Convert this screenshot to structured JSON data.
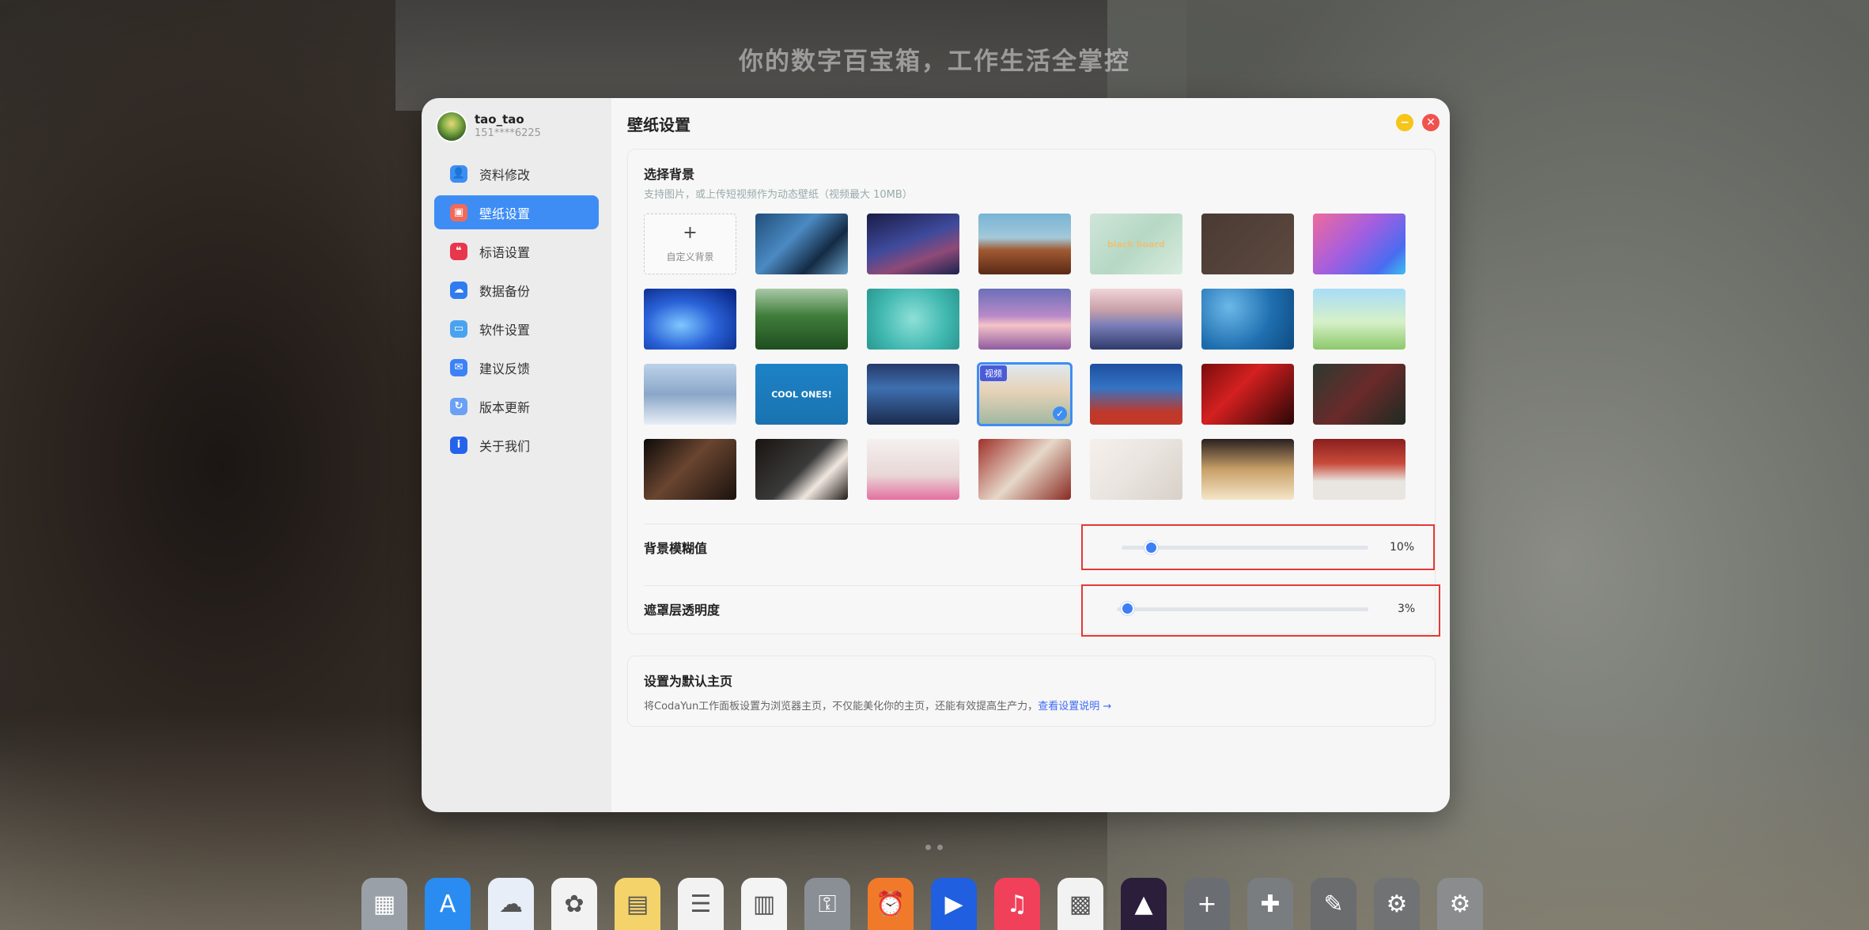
{
  "background": {
    "slogan": "你的数字百宝箱，工作生活全掌控"
  },
  "sidebar": {
    "user": {
      "name": "tao_tao",
      "phone": "151****6225"
    },
    "items": [
      {
        "label": "资料修改",
        "icon": "user-edit-icon",
        "color": "#3e8df5",
        "active": false
      },
      {
        "label": "壁纸设置",
        "icon": "wallpaper-icon",
        "color": "#f06a5a",
        "active": true
      },
      {
        "label": "标语设置",
        "icon": "slogan-icon",
        "color": "#e8364b",
        "active": false
      },
      {
        "label": "数据备份",
        "icon": "cloud-icon",
        "color": "#2f7cf0",
        "active": false
      },
      {
        "label": "软件设置",
        "icon": "monitor-icon",
        "color": "#4aa3f0",
        "active": false
      },
      {
        "label": "建议反馈",
        "icon": "feedback-icon",
        "color": "#3b82f6",
        "active": false
      },
      {
        "label": "版本更新",
        "icon": "update-icon",
        "color": "#6aa0f5",
        "active": false
      },
      {
        "label": "关于我们",
        "icon": "info-icon",
        "color": "#2563eb",
        "active": false
      }
    ]
  },
  "main": {
    "title": "壁纸设置",
    "background_section": {
      "title": "选择背景",
      "subtitle": "支持图片，或上传短视频作为动态壁纸（视频最大 10MB）",
      "add_label": "自定义背景",
      "add_symbol": "+",
      "video_badge": "视频",
      "selected_index": 17,
      "wallpaper_texts": {
        "4": "black board",
        "15": "COOL ONES!"
      }
    },
    "blur": {
      "label": "背景模糊值",
      "value_text": "10%",
      "value": 10
    },
    "mask": {
      "label": "遮罩层透明度",
      "value_text": "3%",
      "value": 3
    },
    "homepage": {
      "title": "设置为默认主页",
      "description": "将CodaYun工作面板设置为浏览器主页，不仅能美化你的主页，还能有效提高生产力，",
      "link": "查看设置说明 →"
    }
  },
  "dock": [
    "launchpad-icon",
    "app-store-icon",
    "icloud-icon",
    "photos-icon",
    "notes-icon",
    "reminders-icon",
    "calendar-icon",
    "keychain-icon",
    "alarm-icon",
    "player-icon",
    "music-icon",
    "qrcode-icon",
    "photo-editor-icon",
    "add-icon",
    "puzzle-icon",
    "brush-icon",
    "settings-gear-icon",
    "system-preferences-icon"
  ]
}
